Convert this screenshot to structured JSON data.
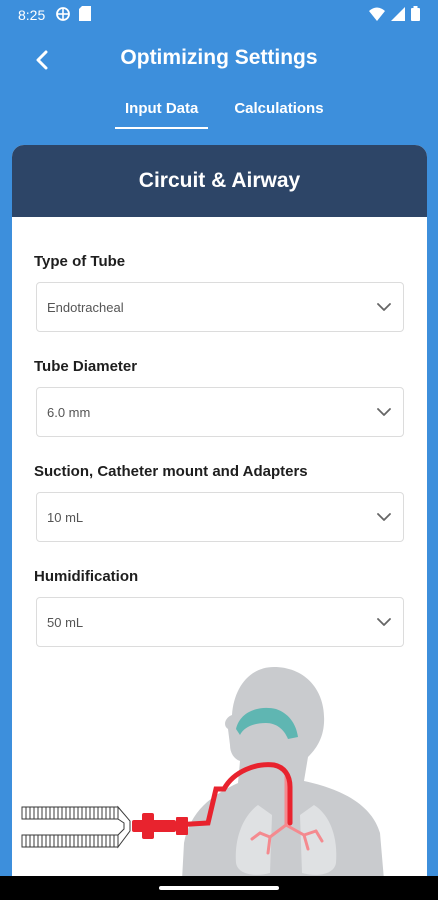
{
  "status_bar": {
    "time": "8:25",
    "left_icons": [
      "vpn-icon",
      "sim-card-icon"
    ],
    "right_icons": [
      "wifi-icon",
      "signal-icon",
      "battery-icon"
    ]
  },
  "header": {
    "title": "Optimizing Settings",
    "tabs": [
      {
        "label": "Input Data",
        "active": true
      },
      {
        "label": "Calculations",
        "active": false
      }
    ]
  },
  "card": {
    "title": "Circuit & Airway",
    "fields": [
      {
        "label": "Type of Tube",
        "value": "Endotracheal"
      },
      {
        "label": "Tube Diameter",
        "value": "6.0 mm"
      },
      {
        "label": "Suction, Catheter mount and Adapters",
        "value": "10 mL"
      },
      {
        "label": "Humidification",
        "value": "50 mL"
      }
    ]
  },
  "colors": {
    "background": "#3d8fdc",
    "card_header": "#2d4567",
    "tube_red": "#e8232e",
    "airway_teal": "#5fb6b2"
  }
}
